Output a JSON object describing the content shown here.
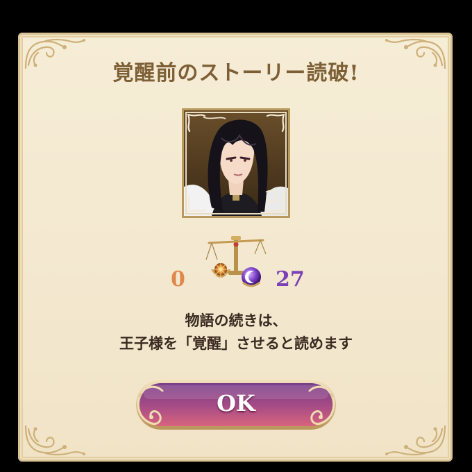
{
  "dialog": {
    "title": "覚醒前のストーリー読破!",
    "portrait_icon": "prince-portrait",
    "scales_icon": "balance-scales-icon",
    "sun_orb_icon": "sun-orb-icon",
    "moon_orb_icon": "moon-orb-icon",
    "left_count": "0",
    "right_count": "27",
    "message_line1": "物語の続きは、",
    "message_line2": "王子様を「覚醒」させると読めます",
    "ok_label": "OK"
  },
  "colors": {
    "panel_bg": "#f4eacf",
    "title": "#7d5f36",
    "left_count": "#e0884a",
    "right_count": "#7b3fb7",
    "message": "#3b2a20",
    "button_top": "#7a3f8a",
    "button_bottom": "#d4607e"
  }
}
